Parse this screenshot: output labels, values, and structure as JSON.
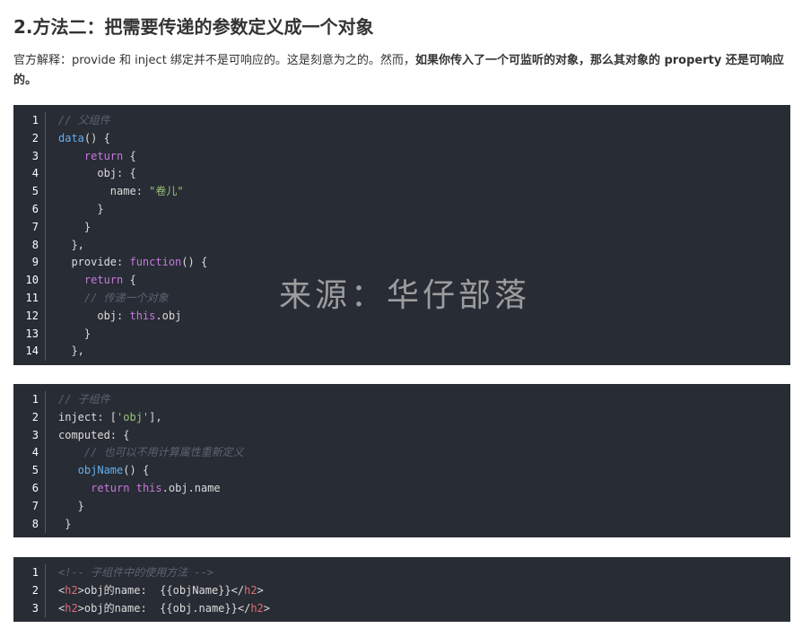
{
  "heading": "2.方法二：把需要传递的参数定义成一个对象",
  "paragraph": {
    "normal": "官方解释：provide 和 inject 绑定并不是可响应的。这是刻意为之的。然而，",
    "bold": "如果你传入了一个可监听的对象，那么其对象的 property 还是可响应的。"
  },
  "watermark": "来源：华仔部落",
  "colors": {
    "code_bg": "#282c34",
    "comment": "#5c6370",
    "function": "#61afef",
    "keyword": "#c678dd",
    "string": "#98c379",
    "tag": "#e06c75"
  },
  "code_blocks": [
    {
      "lines": [
        {
          "num": "1",
          "tokens": [
            {
              "t": "// 父组件",
              "c": "comment"
            }
          ]
        },
        {
          "num": "2",
          "tokens": [
            {
              "t": "data",
              "c": "fn"
            },
            {
              "t": "() {",
              "c": "plain"
            }
          ]
        },
        {
          "num": "3",
          "tokens": [
            {
              "t": "    ",
              "c": "plain"
            },
            {
              "t": "return",
              "c": "kw"
            },
            {
              "t": " {",
              "c": "plain"
            }
          ]
        },
        {
          "num": "4",
          "tokens": [
            {
              "t": "      obj: {",
              "c": "plain"
            }
          ]
        },
        {
          "num": "5",
          "tokens": [
            {
              "t": "        name: ",
              "c": "plain"
            },
            {
              "t": "\"卷儿\"",
              "c": "str"
            }
          ]
        },
        {
          "num": "6",
          "tokens": [
            {
              "t": "      }",
              "c": "plain"
            }
          ]
        },
        {
          "num": "7",
          "tokens": [
            {
              "t": "    }",
              "c": "plain"
            }
          ]
        },
        {
          "num": "8",
          "tokens": [
            {
              "t": "  },",
              "c": "plain"
            }
          ]
        },
        {
          "num": "9",
          "tokens": [
            {
              "t": "  provide: ",
              "c": "plain"
            },
            {
              "t": "function",
              "c": "kw"
            },
            {
              "t": "() {",
              "c": "plain"
            }
          ]
        },
        {
          "num": "10",
          "tokens": [
            {
              "t": "    ",
              "c": "plain"
            },
            {
              "t": "return",
              "c": "kw"
            },
            {
              "t": " {",
              "c": "plain"
            }
          ]
        },
        {
          "num": "11",
          "tokens": [
            {
              "t": "    ",
              "c": "plain"
            },
            {
              "t": "// 传递一个对象",
              "c": "comment"
            }
          ]
        },
        {
          "num": "12",
          "tokens": [
            {
              "t": "      obj: ",
              "c": "plain"
            },
            {
              "t": "this",
              "c": "kw"
            },
            {
              "t": ".obj",
              "c": "plain"
            }
          ]
        },
        {
          "num": "13",
          "tokens": [
            {
              "t": "    }",
              "c": "plain"
            }
          ]
        },
        {
          "num": "14",
          "tokens": [
            {
              "t": "  },",
              "c": "plain"
            }
          ]
        }
      ]
    },
    {
      "lines": [
        {
          "num": "1",
          "tokens": [
            {
              "t": "// 子组件",
              "c": "comment"
            }
          ]
        },
        {
          "num": "2",
          "tokens": [
            {
              "t": "inject: [",
              "c": "plain"
            },
            {
              "t": "'obj'",
              "c": "str"
            },
            {
              "t": "],",
              "c": "plain"
            }
          ]
        },
        {
          "num": "3",
          "tokens": [
            {
              "t": "computed: {",
              "c": "plain"
            }
          ]
        },
        {
          "num": "4",
          "tokens": [
            {
              "t": "    ",
              "c": "plain"
            },
            {
              "t": "// 也可以不用计算属性重新定义",
              "c": "comment"
            }
          ]
        },
        {
          "num": "5",
          "tokens": [
            {
              "t": "   ",
              "c": "plain"
            },
            {
              "t": "objName",
              "c": "fn"
            },
            {
              "t": "() {",
              "c": "plain"
            }
          ]
        },
        {
          "num": "6",
          "tokens": [
            {
              "t": "     ",
              "c": "plain"
            },
            {
              "t": "return",
              "c": "kw"
            },
            {
              "t": " ",
              "c": "plain"
            },
            {
              "t": "this",
              "c": "kw"
            },
            {
              "t": ".obj.name",
              "c": "plain"
            }
          ]
        },
        {
          "num": "7",
          "tokens": [
            {
              "t": "   }",
              "c": "plain"
            }
          ]
        },
        {
          "num": "8",
          "tokens": [
            {
              "t": " }",
              "c": "plain"
            }
          ]
        }
      ]
    },
    {
      "lines": [
        {
          "num": "1",
          "tokens": [
            {
              "t": "<!-- 子组件中的使用方法 -->",
              "c": "comment"
            }
          ]
        },
        {
          "num": "2",
          "tokens": [
            {
              "t": "<",
              "c": "plain"
            },
            {
              "t": "h2",
              "c": "tag"
            },
            {
              "t": ">obj的name:  {{objName}}</",
              "c": "plain"
            },
            {
              "t": "h2",
              "c": "tag"
            },
            {
              "t": ">",
              "c": "plain"
            }
          ]
        },
        {
          "num": "3",
          "tokens": [
            {
              "t": "<",
              "c": "plain"
            },
            {
              "t": "h2",
              "c": "tag"
            },
            {
              "t": ">obj的name:  {{obj.name}}</",
              "c": "plain"
            },
            {
              "t": "h2",
              "c": "tag"
            },
            {
              "t": ">",
              "c": "plain"
            }
          ]
        }
      ]
    }
  ]
}
